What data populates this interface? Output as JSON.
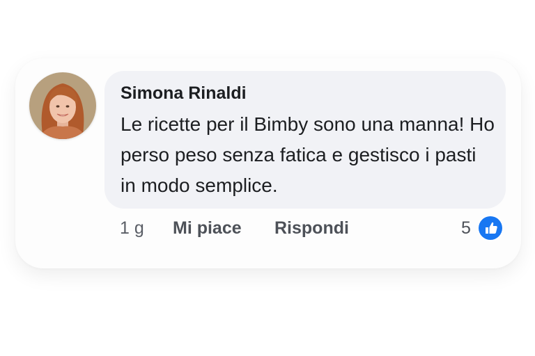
{
  "comment": {
    "author": "Simona Rinaldi",
    "text": "Le ricette per il Bimby sono una manna! Ho perso peso senza fatica e gestisco i pasti in modo semplice.",
    "time": "1 g",
    "like_label": "Mi piace",
    "reply_label": "Rispondi",
    "reaction_count": "5",
    "reaction_icon": "thumbs-up-icon",
    "colors": {
      "bubble": "#f1f2f6",
      "reaction": "#1877f2",
      "text": "#1c1e21",
      "muted": "#5a5e66"
    }
  }
}
